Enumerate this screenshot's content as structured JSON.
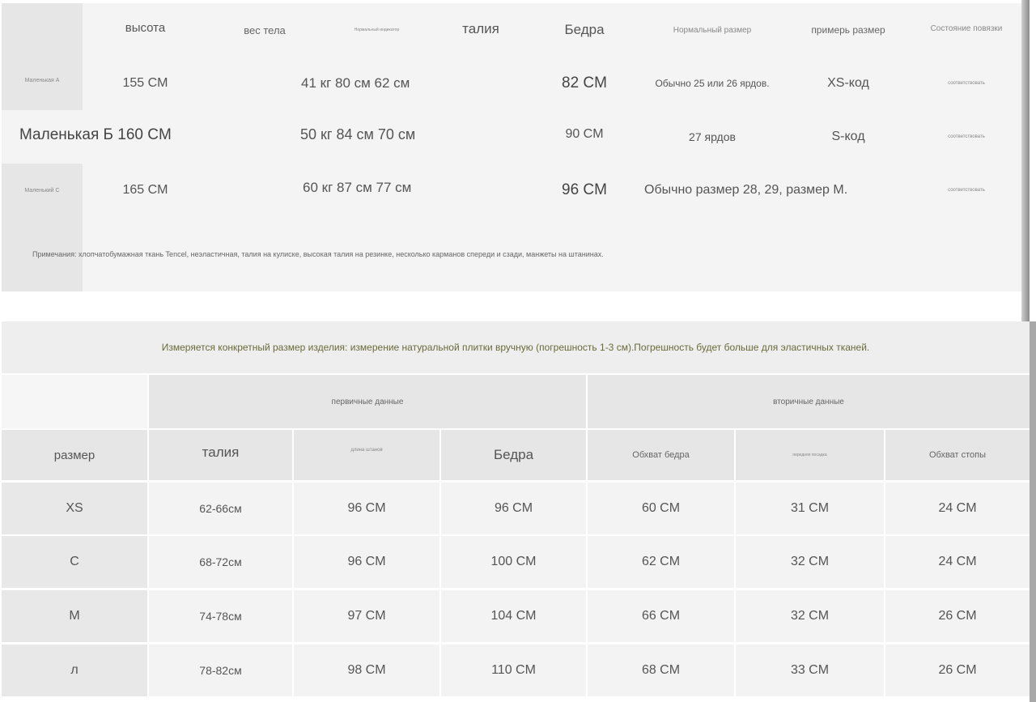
{
  "table1": {
    "headers": {
      "height": "высота",
      "weight": "вес тела",
      "tiny": "Нормальный индикатор",
      "waist": "талия",
      "hips": "Бедра",
      "normal_size": "Нормальный размер",
      "fitting_size": "примерь размер",
      "bandage_state": "Состояние повязки"
    },
    "rows": [
      {
        "name": "Маленькая А",
        "height": "155 CM",
        "weight_waist": "41 кг 80 см 62 см",
        "hips": "82 CM",
        "normal": "Обычно 25 или 26 ярдов.",
        "fit": "XS-код",
        "state": "соответствовать"
      },
      {
        "name": "Маленькая Б 160 CM",
        "height": "",
        "weight_waist": "50 кг 84 см 70 см",
        "hips": "90 CM",
        "normal": "27 ярдов",
        "fit": "S-код",
        "state": "соответствовать"
      },
      {
        "name": "Маленький С",
        "height": "165 CM",
        "weight_waist": "60 кг 87 см 77 см",
        "hips": "96 CM",
        "normal": "Обычно размер 28, 29, размер М.",
        "fit": "",
        "state": "соответствовать"
      }
    ],
    "notes": "Примечания: хлопчатобумажная ткань Tencel, неэластичная, талия на кулиске, высокая талия на резинке, несколько карманов спереди и сзади, манжеты на штанинах."
  },
  "banner": "Измеряется конкретный размер изделия: измерение натуральной плитки вручную (погрешность 1-3 см).Погрешность будет больше для эластичных тканей.",
  "table2": {
    "group_primary": "первичные данные",
    "group_secondary": "вторичные данные",
    "headers": {
      "size": "размер",
      "waist": "талия",
      "length": "длина штанов",
      "hips": "Бедра",
      "thigh": "Обхват бедра",
      "crotch": "передняя посадка",
      "foot": "Обхват стопы"
    },
    "rows": [
      {
        "size": "XS",
        "waist": "62-66см",
        "length": "96 CM",
        "hips": "96 CM",
        "thigh": "60 CM",
        "crotch": "31 CM",
        "foot": "24 CM"
      },
      {
        "size": "С",
        "waist": "68-72см",
        "length": "96 CM",
        "hips": "100 CM",
        "thigh": "62 CM",
        "crotch": "32 CM",
        "foot": "24 CM"
      },
      {
        "size": "М",
        "waist": "74-78см",
        "length": "97 CM",
        "hips": "104 CM",
        "thigh": "66 CM",
        "crotch": "32 CM",
        "foot": "26 CM"
      },
      {
        "size": "л",
        "waist": "78-82см",
        "length": "98 CM",
        "hips": "110 CM",
        "thigh": "68 CM",
        "crotch": "33 CM",
        "foot": "26 CM"
      }
    ]
  }
}
